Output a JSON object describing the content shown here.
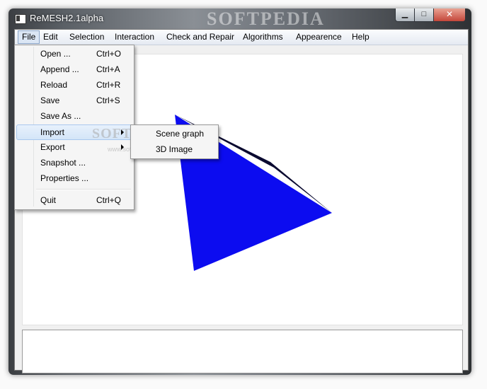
{
  "window": {
    "title": "ReMESH2.1alpha",
    "minimize_glyph": "▁",
    "maximize_glyph": "□",
    "close_glyph": "✕"
  },
  "watermark": {
    "main": "SOFTPEDIA",
    "sub": "www.softpedia.com"
  },
  "menubar": {
    "items": [
      "File",
      "Edit",
      "Selection",
      "Interaction",
      "Check and Repair",
      "Algorithms",
      "Appearence",
      "Help"
    ],
    "active": "File"
  },
  "file_menu": {
    "items": [
      {
        "label": "Open ...",
        "shortcut": "Ctrl+O"
      },
      {
        "label": "Append ...",
        "shortcut": "Ctrl+A"
      },
      {
        "label": "Reload",
        "shortcut": "Ctrl+R"
      },
      {
        "label": "Save",
        "shortcut": "Ctrl+S"
      },
      {
        "label": "Save As ...",
        "shortcut": ""
      },
      {
        "label": "Import",
        "shortcut": "",
        "submenu": true
      },
      {
        "label": "Export",
        "shortcut": "",
        "submenu": true
      },
      {
        "label": "Snapshot ...",
        "shortcut": ""
      },
      {
        "label": "Properties ...",
        "shortcut": ""
      },
      {
        "label": "Quit",
        "shortcut": "Ctrl+Q"
      }
    ],
    "highlighted": "Import"
  },
  "import_submenu": {
    "items": [
      "Scene graph",
      "3D Image"
    ]
  },
  "viewport": {
    "shape_color": "#0c0cf0",
    "edge_color": "#0a0a30"
  },
  "colors": {
    "menu_highlight": "#d4e5f8",
    "active_menu": "#dbe6f4"
  },
  "console": {
    "text": ""
  }
}
